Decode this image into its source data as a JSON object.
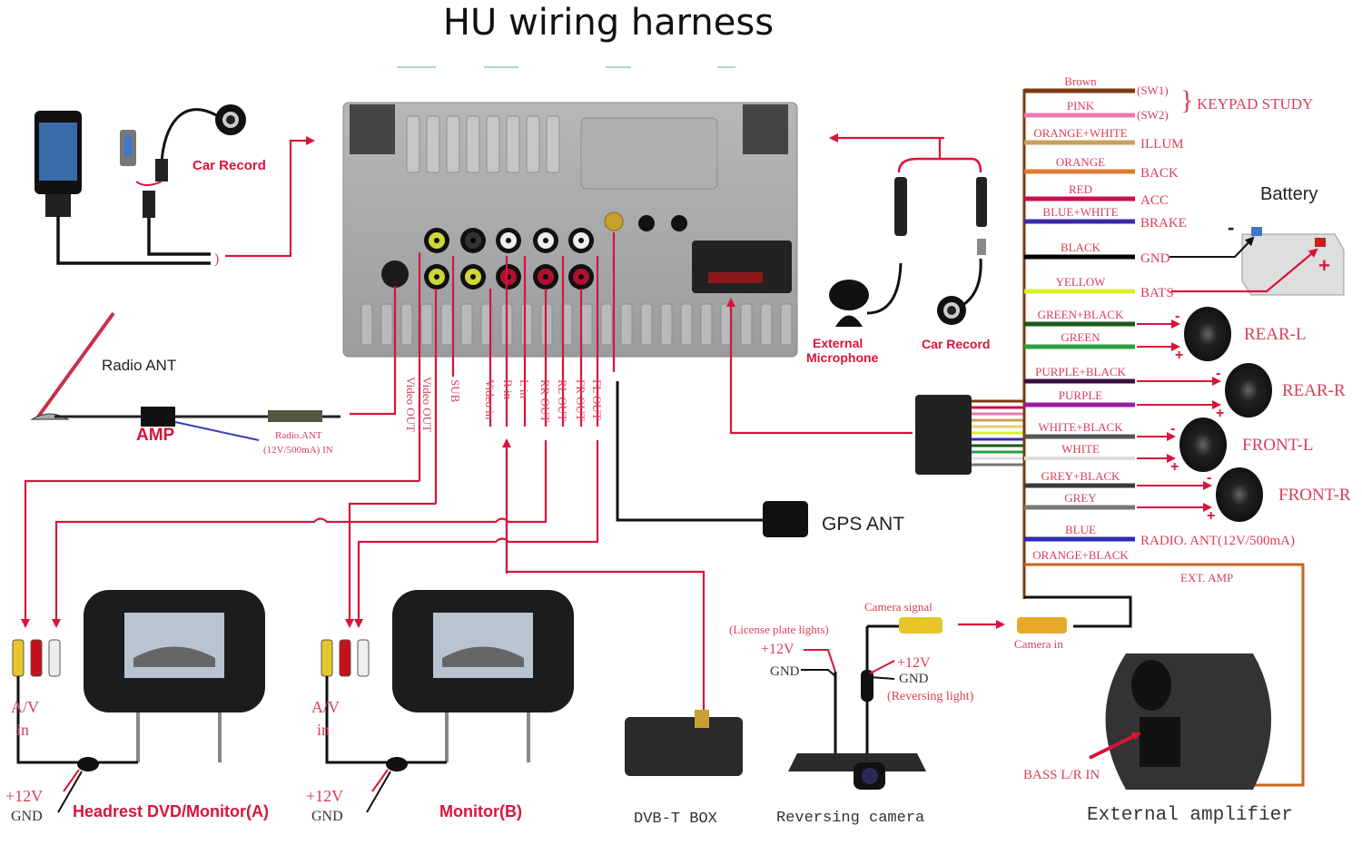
{
  "title": "HU wiring harness",
  "colors": {
    "accent_red": "#d8143a",
    "panel_grey": "#a9abad",
    "harness_brown": "#7a3a12",
    "amp_orange": "#c8641e"
  },
  "top_left": {
    "car_record_label": "Car Record",
    "devices": [
      "ipod-icon",
      "usb-stick-icon",
      "car-record-camera-icon"
    ]
  },
  "top_right": {
    "external_microphone_label": [
      "External",
      "Microphone"
    ],
    "car_record_label": "Car Record"
  },
  "radio": {
    "antenna_label": "Radio ANT",
    "amp_label": "AMP",
    "input_label_line1": "Radio.ANT",
    "input_label_line2": "(12V/500mA) IN"
  },
  "port_labels": [
    "Video OUT",
    "Video OUT",
    "SUB",
    "Video in",
    "R in",
    "L in",
    "RR OUT",
    "RL OUT",
    "FR OUT",
    "FL OUT"
  ],
  "harness": {
    "wires": [
      {
        "color_name": "Brown",
        "hex": "#7a3a12",
        "function": "(SW1)"
      },
      {
        "color_name": "PINK",
        "hex": "#e87ab4",
        "function": "(SW2)"
      },
      {
        "color_name": "ORANGE+WHITE",
        "hex": "#c9a060",
        "function": "ILLUM"
      },
      {
        "color_name": "ORANGE",
        "hex": "#e07a30",
        "function": "BACK"
      },
      {
        "color_name": "RED",
        "hex": "#c8104a",
        "function": "ACC"
      },
      {
        "color_name": "BLUE+WHITE",
        "hex": "#3a2aa8",
        "function": "BRAKE"
      },
      {
        "color_name": "BLACK",
        "hex": "#000000",
        "function": "GND"
      },
      {
        "color_name": "YELLOW",
        "hex": "#d8ef2a",
        "function": "BATS"
      },
      {
        "color_name": "GREEN+BLACK",
        "hex": "#1a5a1a",
        "function": ""
      },
      {
        "color_name": "GREEN",
        "hex": "#2aa040",
        "function": ""
      },
      {
        "color_name": "PURPLE+BLACK",
        "hex": "#3a1040",
        "function": ""
      },
      {
        "color_name": "PURPLE",
        "hex": "#9a1aa0",
        "function": ""
      },
      {
        "color_name": "WHITE+BLACK",
        "hex": "#555555",
        "function": ""
      },
      {
        "color_name": "WHITE",
        "hex": "#dddddd",
        "function": ""
      },
      {
        "color_name": "GREY+BLACK",
        "hex": "#3a3a3a",
        "function": ""
      },
      {
        "color_name": "GREY",
        "hex": "#777777",
        "function": ""
      },
      {
        "color_name": "BLUE",
        "hex": "#2a2ab8",
        "function": "RADIO. ANT(12V/500mA)"
      },
      {
        "color_name": "ORANGE+BLACK",
        "hex": "#3a2a10",
        "function": "EXT. AMP"
      }
    ],
    "keypad_label": "KEYPAD STUDY",
    "battery_label": "Battery",
    "battery_minus": "-",
    "battery_plus": "+",
    "speakers": [
      "REAR-L",
      "REAR-R",
      "FRONT-L",
      "FRONT-R"
    ],
    "speaker_minus": "-",
    "speaker_plus": "+"
  },
  "gps": {
    "label": "GPS ANT"
  },
  "monitors": [
    {
      "title": "Headrest DVD/Monitor(A)",
      "av_label_1": "A/V",
      "av_label_2": "in",
      "plus12v": "+12V",
      "gnd": "GND"
    },
    {
      "title": "Monitor(B)",
      "av_label_1": "A/V",
      "av_label_2": "in",
      "plus12v": "+12V",
      "gnd": "GND"
    }
  ],
  "dvbt": {
    "label": "DVB-T BOX"
  },
  "reversing_camera": {
    "label": "Reversing camera",
    "license_plate": "(License plate lights)",
    "plus12v_a": "+12V",
    "gnd_a": "GND",
    "camera_signal": "Camera signal",
    "plus12v_b": "+12V",
    "gnd_b": "GND",
    "reversing_light": "(Reversing light)",
    "camera_in": "Camera in"
  },
  "amplifier": {
    "label": "External amplifier",
    "bass_label": "BASS L/R IN"
  }
}
